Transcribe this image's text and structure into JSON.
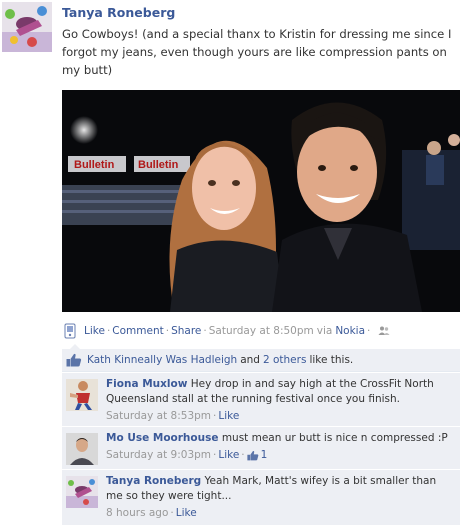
{
  "post": {
    "author": "Tanya Roneberg",
    "text": "Go Cowboys! (and a special thanx to Kristin for dressing me since I forgot my jeans, even though yours are like compression pants on my butt)",
    "actions": {
      "like": "Like",
      "comment": "Comment",
      "share": "Share",
      "timestamp": "Saturday at 8:50pm",
      "via_prefix": "via",
      "via_app": "Nokia"
    }
  },
  "likes": {
    "names": "Kath Kinneally Was Hadleigh",
    "and": "and",
    "others": "2 others",
    "suffix": "like this."
  },
  "comments": [
    {
      "author": "Fiona Muxlow",
      "text": "Hey drop in and say high at the CrossFit North Queensland stall at the running festival once you finish.",
      "time": "Saturday at 8:53pm",
      "like": "Like"
    },
    {
      "author": "Mo Use Moorhouse",
      "text": "must mean ur butt is nice n compressed :P",
      "time": "Saturday at 9:03pm",
      "like": "Like",
      "like_count": "1"
    },
    {
      "author": "Tanya Roneberg",
      "text": "Yeah Mark, Matt's wifey is a bit smaller than me so they were tight...",
      "time": "8 hours ago",
      "like": "Like"
    }
  ],
  "photo_signs": [
    "Bulletin",
    "Bulletin"
  ],
  "colors": {
    "link": "#3b5998",
    "muted": "#999999",
    "panel": "#edeff4"
  }
}
